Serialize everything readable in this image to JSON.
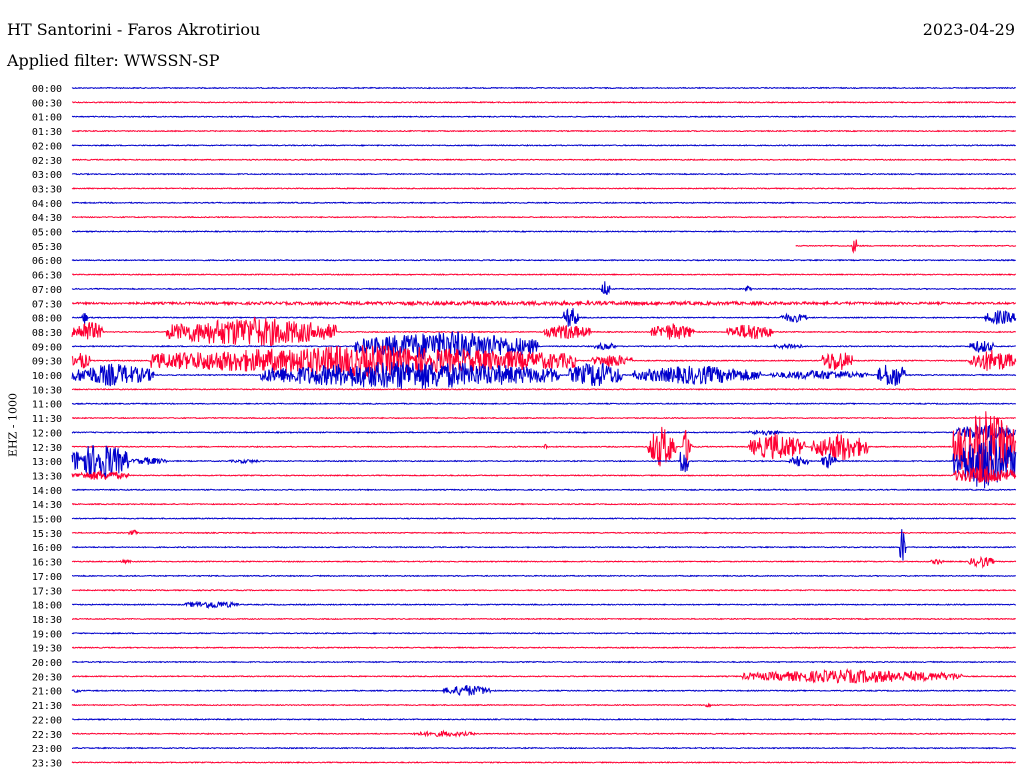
{
  "header": {
    "station": "HT Santorini - Faros Akrotiriou",
    "date": "2023-04-29",
    "filter": "Applied filter: WWSSN-SP",
    "channel": "EHZ - 1000"
  },
  "colors": {
    "even_trace": "#0000cc",
    "odd_trace": "#ff0033",
    "background": "#ffffff"
  },
  "chart_data": {
    "type": "line",
    "title": "HT Santorini - Faros Akrotiriou",
    "ylabel": "EHZ - 1000",
    "row_labels": [
      "00:00",
      "00:30",
      "01:00",
      "01:30",
      "02:00",
      "02:30",
      "03:00",
      "03:30",
      "04:00",
      "04:30",
      "05:00",
      "05:30",
      "06:00",
      "06:30",
      "07:00",
      "07:30",
      "08:00",
      "08:30",
      "09:00",
      "09:30",
      "10:00",
      "10:30",
      "11:00",
      "11:30",
      "12:00",
      "12:30",
      "13:00",
      "13:30",
      "14:00",
      "14:30",
      "15:00",
      "15:30",
      "16:00",
      "16:30",
      "17:00",
      "17:30",
      "18:00",
      "18:30",
      "19:00",
      "19:30",
      "20:00",
      "20:30",
      "21:00",
      "21:30",
      "22:00",
      "22:30",
      "23:00",
      "23:30"
    ],
    "x_unit": "minutes",
    "x_range": [
      0,
      30
    ],
    "traces": [
      {
        "row": 11,
        "baseline_min": 23,
        "events": [
          {
            "start": 24.8,
            "end": 25.0,
            "amp": 10
          }
        ]
      },
      {
        "row": 14,
        "events": [
          {
            "start": 16.8,
            "end": 17.1,
            "amp": 9
          },
          {
            "start": 21.4,
            "end": 21.6,
            "amp": 5
          }
        ]
      },
      {
        "row": 15,
        "events": [
          {
            "start": 0,
            "end": 30,
            "amp": 2
          }
        ]
      },
      {
        "row": 16,
        "events": [
          {
            "start": 0.3,
            "end": 0.5,
            "amp": 7
          },
          {
            "start": 15.6,
            "end": 16.1,
            "amp": 12
          },
          {
            "start": 22.5,
            "end": 23.4,
            "amp": 5
          },
          {
            "start": 29.0,
            "end": 30,
            "amp": 8
          }
        ]
      },
      {
        "row": 17,
        "events": [
          {
            "start": 0,
            "end": 1,
            "amp": 12
          },
          {
            "start": 3.0,
            "end": 8.4,
            "amp": 16
          },
          {
            "start": 15.0,
            "end": 16.5,
            "amp": 8
          },
          {
            "start": 18.4,
            "end": 19.8,
            "amp": 9
          },
          {
            "start": 20.8,
            "end": 22.3,
            "amp": 9
          }
        ]
      },
      {
        "row": 18,
        "events": [
          {
            "start": 9.0,
            "end": 14.8,
            "amp": 16
          },
          {
            "start": 16.6,
            "end": 17.3,
            "amp": 4
          },
          {
            "start": 22.3,
            "end": 23.3,
            "amp": 3
          },
          {
            "start": 28.5,
            "end": 29.3,
            "amp": 7
          }
        ]
      },
      {
        "row": 19,
        "events": [
          {
            "start": 0,
            "end": 0.6,
            "amp": 9
          },
          {
            "start": 2.5,
            "end": 16.0,
            "amp": 16
          },
          {
            "start": 16.5,
            "end": 17.8,
            "amp": 7
          },
          {
            "start": 23.8,
            "end": 24.8,
            "amp": 12
          },
          {
            "start": 28.5,
            "end": 30,
            "amp": 12
          }
        ]
      },
      {
        "row": 20,
        "events": [
          {
            "start": 0,
            "end": 2.6,
            "amp": 12
          },
          {
            "start": 6.0,
            "end": 15.5,
            "amp": 15
          },
          {
            "start": 15.8,
            "end": 17.5,
            "amp": 14
          },
          {
            "start": 17.8,
            "end": 21.9,
            "amp": 10
          },
          {
            "start": 22.2,
            "end": 25.3,
            "amp": 5
          },
          {
            "start": 25.6,
            "end": 26.5,
            "amp": 14
          }
        ]
      },
      {
        "row": 24,
        "events": [
          {
            "start": 21.5,
            "end": 22.5,
            "amp": 3
          },
          {
            "start": 28.0,
            "end": 30,
            "amp": 8
          }
        ]
      },
      {
        "row": 25,
        "events": [
          {
            "start": 15.0,
            "end": 15.1,
            "amp": 5
          },
          {
            "start": 18.3,
            "end": 19.2,
            "amp": 22
          },
          {
            "start": 19.4,
            "end": 19.7,
            "amp": 22
          },
          {
            "start": 21.5,
            "end": 23.3,
            "amp": 14
          },
          {
            "start": 23.5,
            "end": 25.3,
            "amp": 15
          },
          {
            "start": 28.0,
            "end": 30,
            "amp": 38
          }
        ]
      },
      {
        "row": 26,
        "events": [
          {
            "start": 0,
            "end": 1.8,
            "amp": 20
          },
          {
            "start": 1.9,
            "end": 3.0,
            "amp": 4
          },
          {
            "start": 5.0,
            "end": 6.0,
            "amp": 2
          },
          {
            "start": 19.3,
            "end": 19.6,
            "amp": 18
          },
          {
            "start": 22.8,
            "end": 23.4,
            "amp": 6
          },
          {
            "start": 23.8,
            "end": 24.3,
            "amp": 8
          },
          {
            "start": 28.0,
            "end": 30,
            "amp": 30
          }
        ]
      },
      {
        "row": 27,
        "events": [
          {
            "start": 0,
            "end": 1.8,
            "amp": 5
          },
          {
            "start": 28.0,
            "end": 30,
            "amp": 10
          }
        ]
      },
      {
        "row": 31,
        "events": [
          {
            "start": 1.8,
            "end": 2.1,
            "amp": 3
          }
        ]
      },
      {
        "row": 32,
        "events": [
          {
            "start": 26.3,
            "end": 26.5,
            "amp": 22
          }
        ]
      },
      {
        "row": 33,
        "events": [
          {
            "start": 1.5,
            "end": 1.9,
            "amp": 2
          },
          {
            "start": 27.3,
            "end": 27.7,
            "amp": 3
          },
          {
            "start": 28.5,
            "end": 29.3,
            "amp": 6
          }
        ]
      },
      {
        "row": 36,
        "events": [
          {
            "start": 3.6,
            "end": 5.3,
            "amp": 4
          }
        ]
      },
      {
        "row": 41,
        "events": [
          {
            "start": 21.3,
            "end": 28.3,
            "amp": 7
          }
        ]
      },
      {
        "row": 42,
        "events": [
          {
            "start": 0,
            "end": 0.3,
            "amp": 2
          },
          {
            "start": 11.8,
            "end": 13.3,
            "amp": 6
          }
        ]
      },
      {
        "row": 43,
        "events": [
          {
            "start": 20.1,
            "end": 20.3,
            "amp": 3
          }
        ]
      },
      {
        "row": 45,
        "events": [
          {
            "start": 10.8,
            "end": 12.8,
            "amp": 3
          }
        ]
      }
    ]
  }
}
